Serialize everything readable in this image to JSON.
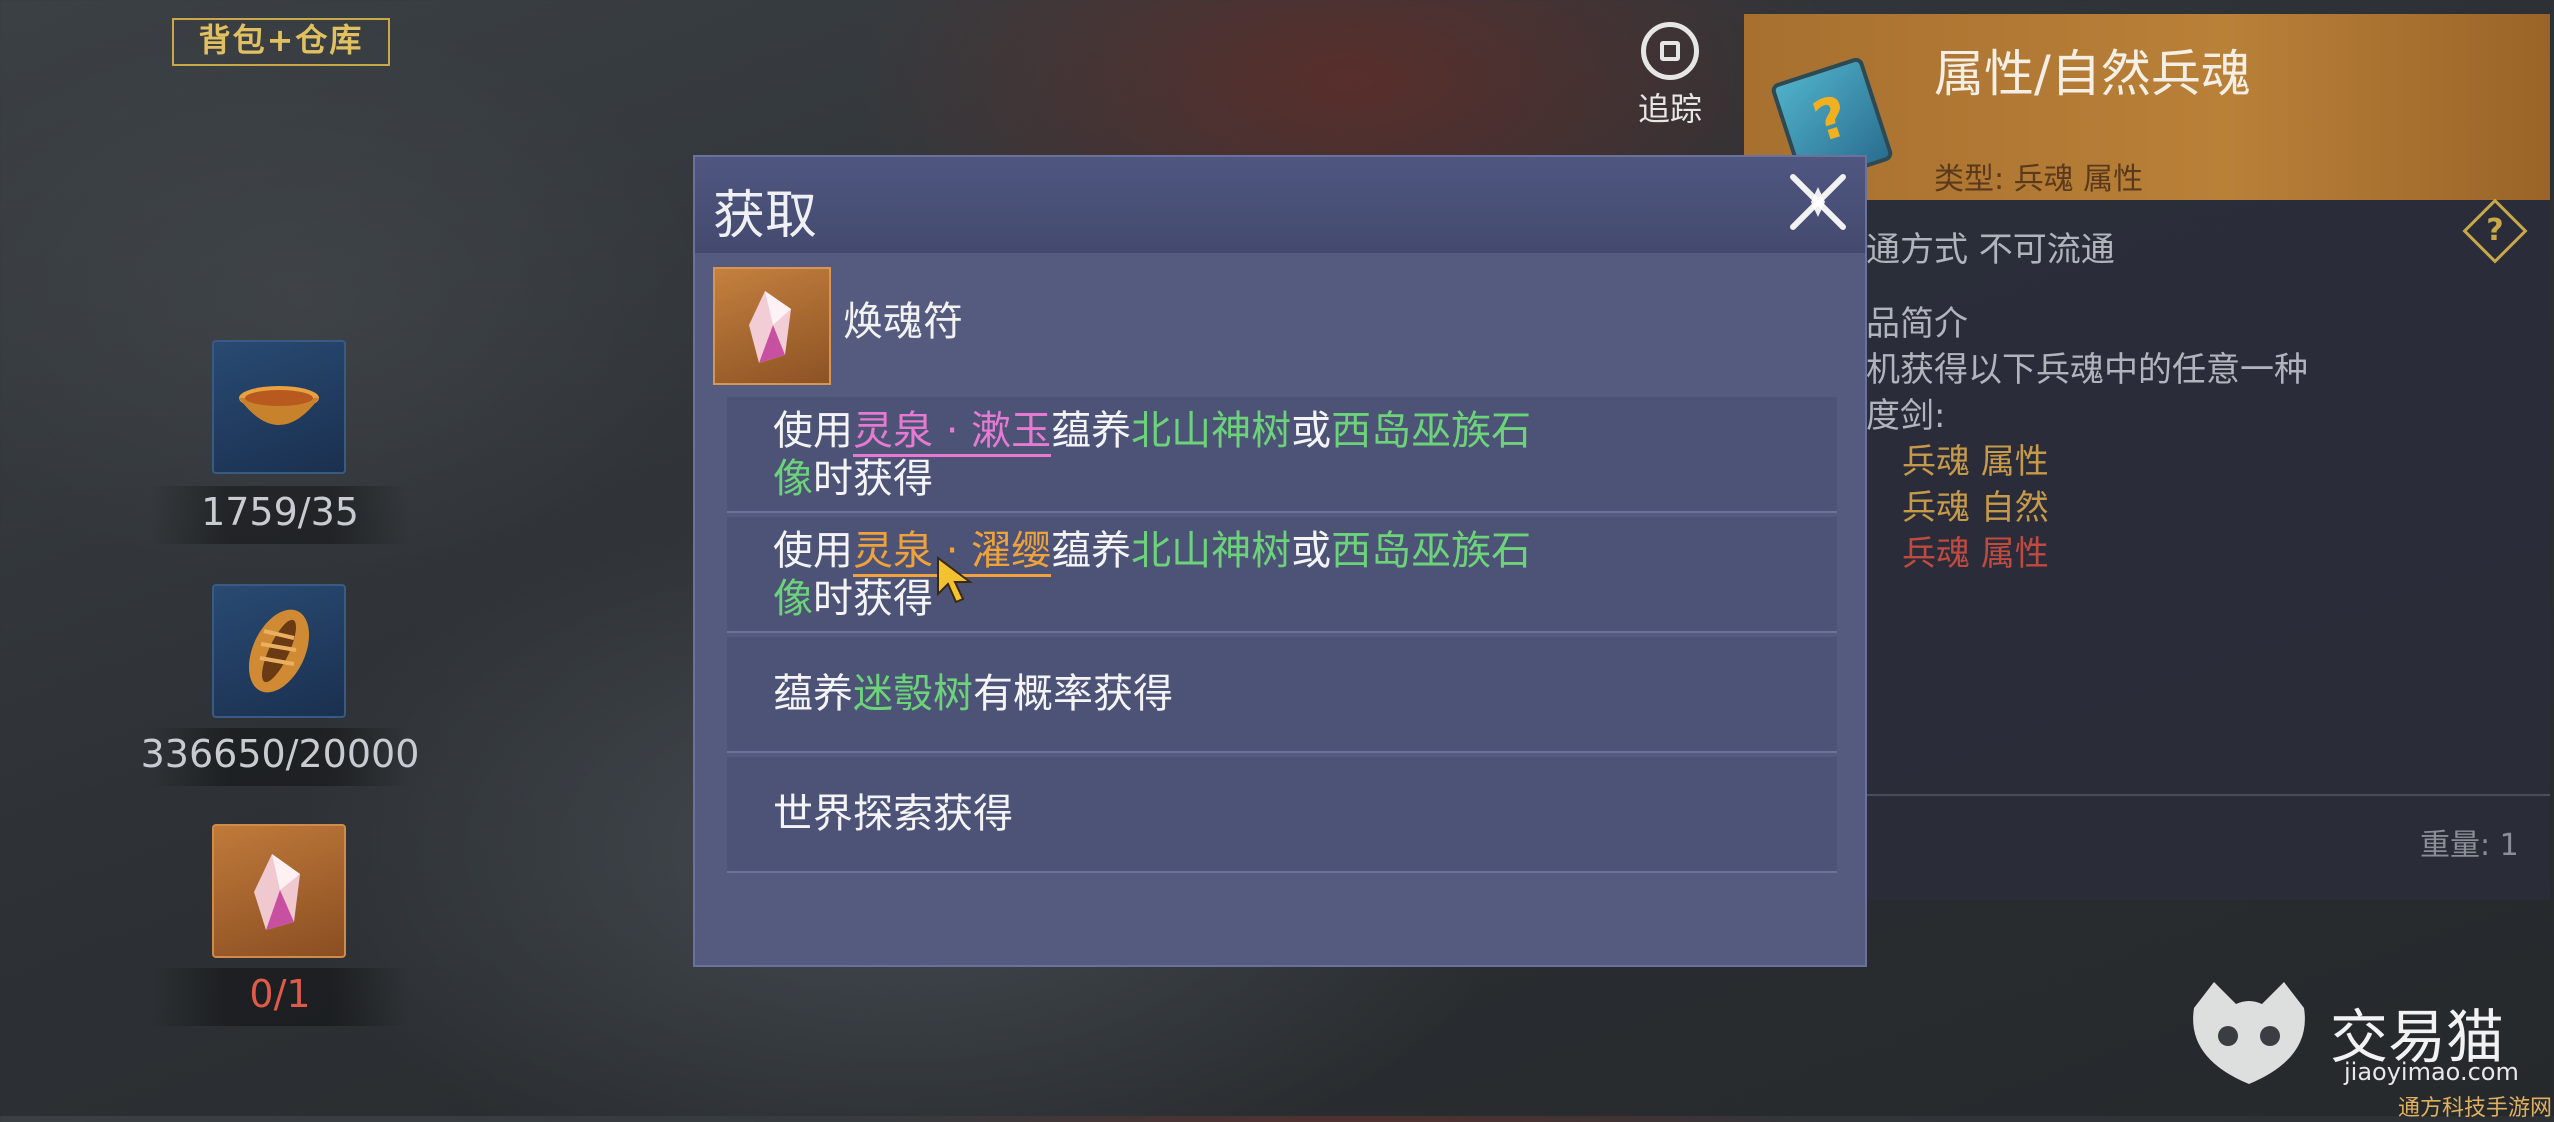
{
  "inventory": {
    "title": "背包+仓库",
    "slots": [
      {
        "icon": "bowl-item-icon",
        "count": "1759/35"
      },
      {
        "icon": "shell-item-icon",
        "count": "336650/20000"
      },
      {
        "icon": "soul-crystal-icon",
        "count": "0/1",
        "count_color": "#e05a4a"
      }
    ]
  },
  "track_button": {
    "label": "追踪",
    "icon": "track-icon"
  },
  "info_panel": {
    "title": "属性/自然兵魂",
    "type": "类型: 兵魂 属性",
    "trade": "通方式   不可流通",
    "intro_label": "品简介",
    "intro_text": "机获得以下兵魂中的任意一种",
    "sword_label": "度剑:",
    "souls": [
      {
        "text": "兵魂 属性",
        "color": "#c79a4a"
      },
      {
        "text": "兵魂 自然",
        "color": "#c79a4a"
      },
      {
        "text": "兵魂 属性",
        "color": "#c04a40"
      }
    ],
    "weight": "重量: 1"
  },
  "dialog": {
    "title": "获取",
    "item_name": "焕魂符",
    "sources": [
      {
        "use": "使用",
        "spring": "灵泉",
        "sep": "·",
        "spring_type": "漱玉",
        "nourish": "蕴养",
        "tree": "北山神树",
        "or": "或",
        "statue_a": "西岛巫族石",
        "statue_b": "像",
        "suffix": "时获得"
      },
      {
        "use": "使用",
        "spring": "灵泉",
        "sep": "·",
        "spring_type": "濯缨",
        "nourish": "蕴养",
        "tree": "北山神树",
        "or": "或",
        "statue_a": "西岛巫族石",
        "statue_b": "像",
        "suffix": "时获得"
      },
      {
        "prefix": "蕴养",
        "tree": "迷彀树",
        "suffix": "有概率获得"
      },
      {
        "text": "世界探索获得"
      }
    ]
  },
  "watermark": {
    "name": "交易猫",
    "url": "jiaoyimao.com",
    "sub": "通方科技手游网"
  },
  "colors": {
    "pink": "#e57ad0",
    "orange": "#f0a23a",
    "green": "#6cd37a",
    "dialog_bg": "#545b7f",
    "panel_header": "#b07836"
  }
}
